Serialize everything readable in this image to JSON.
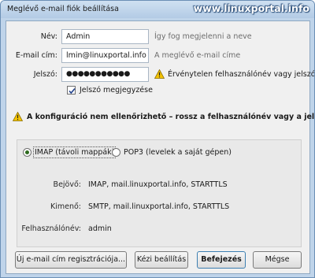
{
  "window": {
    "title": "Meglévő e-mail fiók beállítása",
    "watermark": "www.linuxportal.info"
  },
  "form": {
    "name_label": "Név:",
    "name_value": "Admin",
    "name_hint": "Így fog megjelenni a neve",
    "email_label": "E-mail cím:",
    "email_value": "lmin@linuxportal.info",
    "email_hint": "A meglévő e-mail címe",
    "password_label": "Jelszó:",
    "password_value": "●●●●●●●●●●●",
    "password_hint": "Érvénytelen felhasználónév vagy jelszó",
    "remember_label": "Jelszó megjegyzése",
    "remember_checked": true
  },
  "warning": {
    "text": "A konfiguráció nem ellenőrizhető – rossz a felhasználónév vagy a jelszó?",
    "icon": "warning-triangle-icon"
  },
  "server": {
    "imap_label": "IMAP (távoli mappák)",
    "pop3_label": "POP3 (levelek a saját gépen)",
    "selected": "IMAP",
    "incoming_label": "Bejövő:",
    "incoming_value": "IMAP, mail.linuxportal.info, STARTTLS",
    "outgoing_label": "Kimenő:",
    "outgoing_value": "SMTP, mail.linuxportal.info, STARTTLS",
    "username_label": "Felhasználónév:",
    "username_value": "admin"
  },
  "buttons": {
    "register": "Új e-mail cím regisztrációja...",
    "manual": "Kézi beállítás",
    "finish": "Befejezés",
    "cancel": "Mégse"
  },
  "colors": {
    "warning_fill": "#f5c400",
    "accent_border": "#3c7fb1"
  }
}
